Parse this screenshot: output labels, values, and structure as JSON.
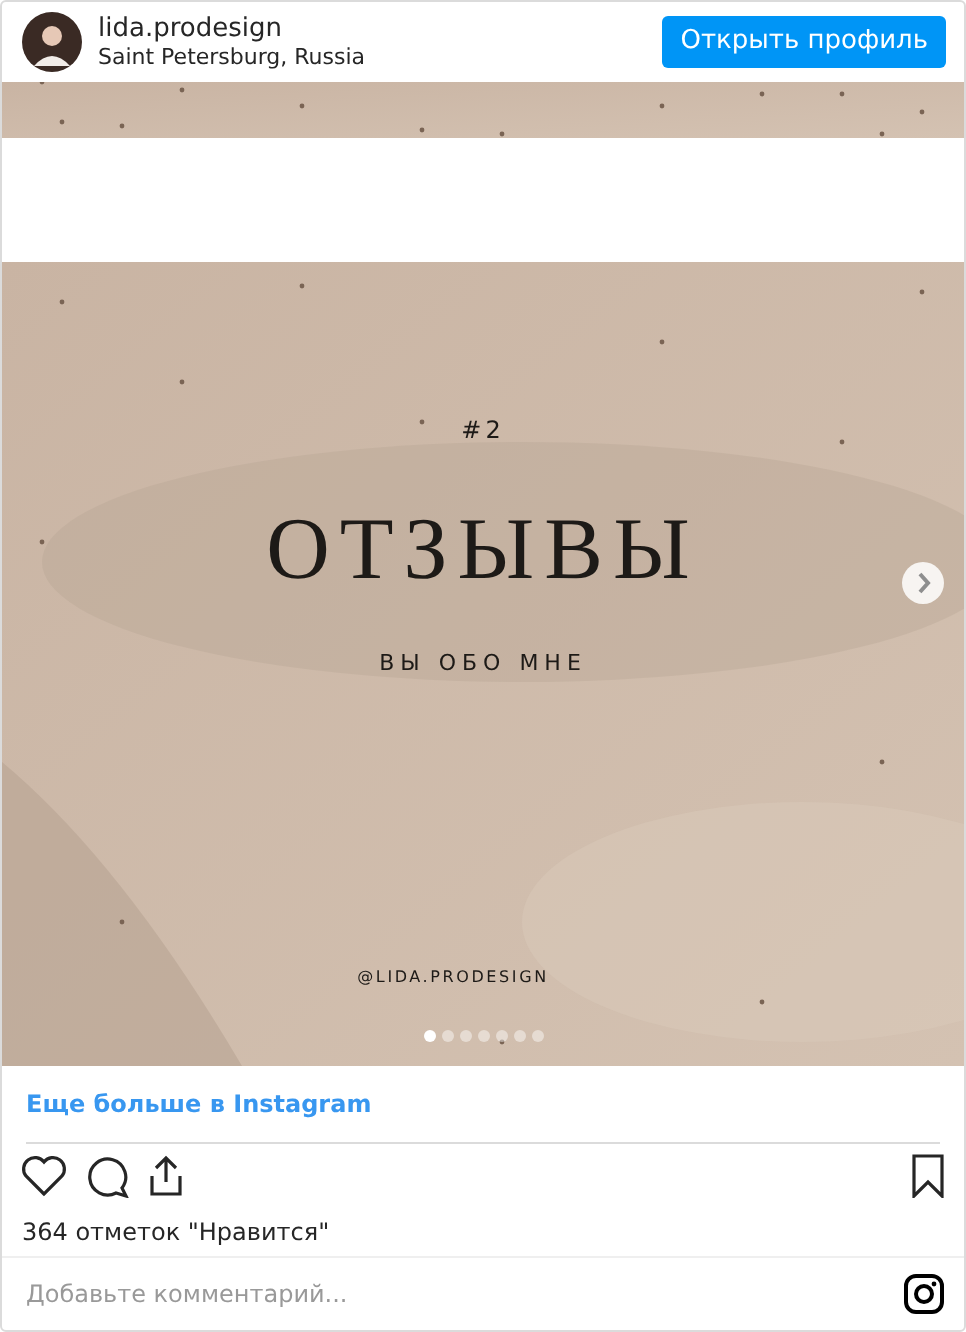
{
  "header": {
    "username": "lida.prodesign",
    "location": "Saint Petersburg, Russia",
    "button": "Открыть профиль"
  },
  "post": {
    "slide": {
      "number": "#2",
      "title": "ОТЗЫВЫ",
      "subtitle": "ВЫ ОБО МНЕ",
      "handle": "@LIDA.PRODESIGN"
    },
    "dots": [
      {
        "selected": true
      },
      {
        "selected": false
      },
      {
        "selected": false
      },
      {
        "selected": false
      },
      {
        "selected": false
      },
      {
        "selected": false
      },
      {
        "selected": false
      }
    ]
  },
  "more_link": "Еще больше в Instagram",
  "likes": "364 отметок \"Нравится\"",
  "comment": {
    "placeholder": "Добавьте комментарий..."
  }
}
